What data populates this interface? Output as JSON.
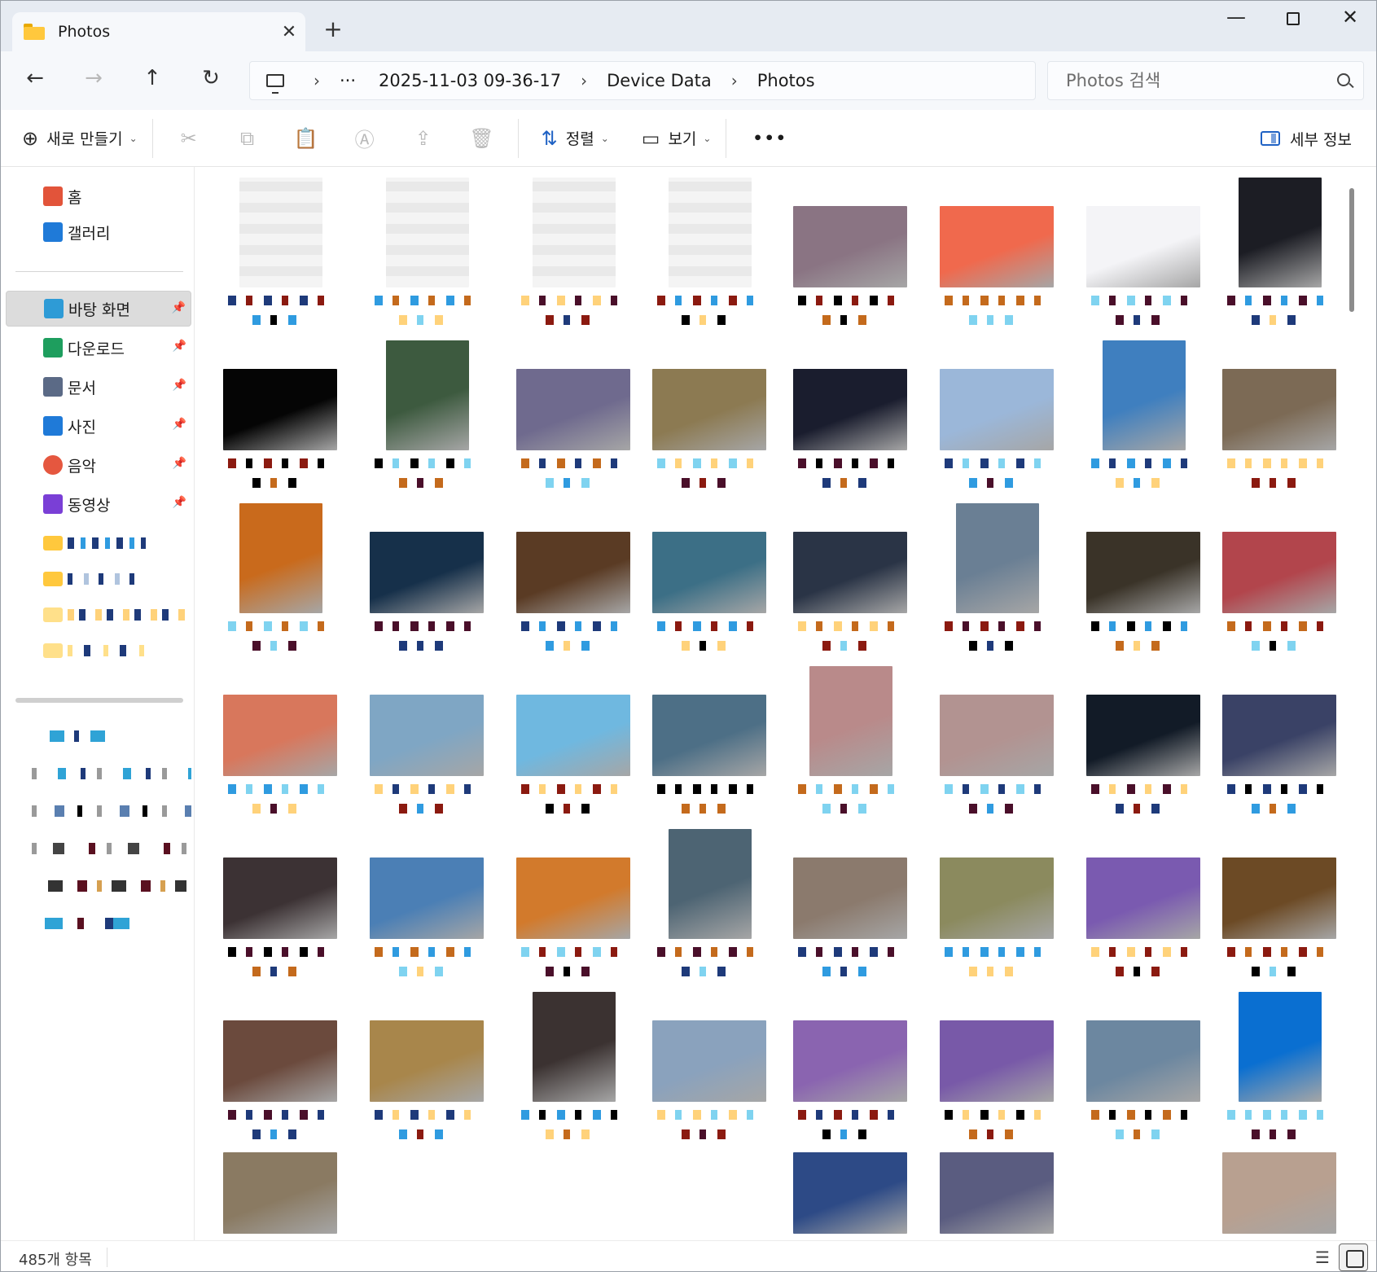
{
  "titlebar": {
    "tab_title": "Photos",
    "tab_close": "✕",
    "new_tab": "+",
    "minimize": "—",
    "close": "✕"
  },
  "navbar": {
    "back": "←",
    "forward": "→",
    "up": "↑",
    "refresh": "↻",
    "breadcrumb_more": "···",
    "breadcrumbs": [
      "2025-11-03 09-36-17",
      "Device Data",
      "Photos"
    ],
    "chevron": "›",
    "search_placeholder": "Photos 검색"
  },
  "commandbar": {
    "new_label": "새로 만들기",
    "new_icon": "⊕",
    "cut_icon": "✂",
    "copy_icon": "⧉",
    "paste_icon": "📋",
    "rename_icon": "Ⓐ",
    "share_icon": "⇪",
    "delete_icon": "🗑",
    "sort_label": "정렬",
    "sort_icon": "⇅",
    "view_label": "보기",
    "view_icon": "▭",
    "more_icon": "•••",
    "caret": "⌄",
    "details_label": "세부 정보"
  },
  "sidebar": {
    "top_items": [
      {
        "label": "홈",
        "color": "#e2543a"
      },
      {
        "label": "갤러리",
        "color": "#1f7ad8"
      }
    ],
    "pinned_items": [
      {
        "label": "바탕 화면",
        "color": "#2e9bd6",
        "selected": true
      },
      {
        "label": "다운로드",
        "color": "#1e9e5e"
      },
      {
        "label": "문서",
        "color": "#5b6a86"
      },
      {
        "label": "사진",
        "color": "#1f7ad8"
      },
      {
        "label": "음악",
        "color": "#e5573f"
      },
      {
        "label": "동영상",
        "color": "#7a3fd6"
      }
    ],
    "pin_icon": "📌"
  },
  "thumbnails": [
    [
      "#eeeeee",
      "#f1f1f1",
      "#f2f2f2",
      "#eef2f7",
      "#8a7483",
      "#f0694d",
      "#f4f4f7",
      "#1c1d24"
    ],
    [
      "#050505",
      "#3d5a3f",
      "#6f6a8e",
      "#8c7a52",
      "#1a1d2e",
      "#9bb7d9",
      "#3f7fbf",
      "#7c6a55"
    ],
    [
      "#c96a1c",
      "#16304a",
      "#5a3b24",
      "#3c6f86",
      "#2a3446",
      "#6a7f94",
      "#3a3328",
      "#b2454c"
    ],
    [
      "#d8775c",
      "#7fa6c4",
      "#6fb8e0",
      "#4d6f86",
      "#b98a8a",
      "#b29391",
      "#121b27",
      "#3a4266"
    ],
    [
      "#3c3234",
      "#4b7fb5",
      "#d27a2c",
      "#4d6473",
      "#8b7a6d",
      "#8b8a5e",
      "#7a5ab0",
      "#6c4a25"
    ],
    [
      "#6b4a3d",
      "#a8864b",
      "#3b3231",
      "#8aa2bd",
      "#8a64b0",
      "#7859a8",
      "#6c87a0",
      "#0a6fd1"
    ],
    [
      "#8a7a62",
      "#ffffff",
      "#ffffff",
      "#ffffff",
      "#2d4a86",
      "#5a5c80",
      "#ffffff",
      "#b8a090"
    ]
  ],
  "status": {
    "item_count": "485개 항목",
    "list_view_icon": "☰"
  }
}
